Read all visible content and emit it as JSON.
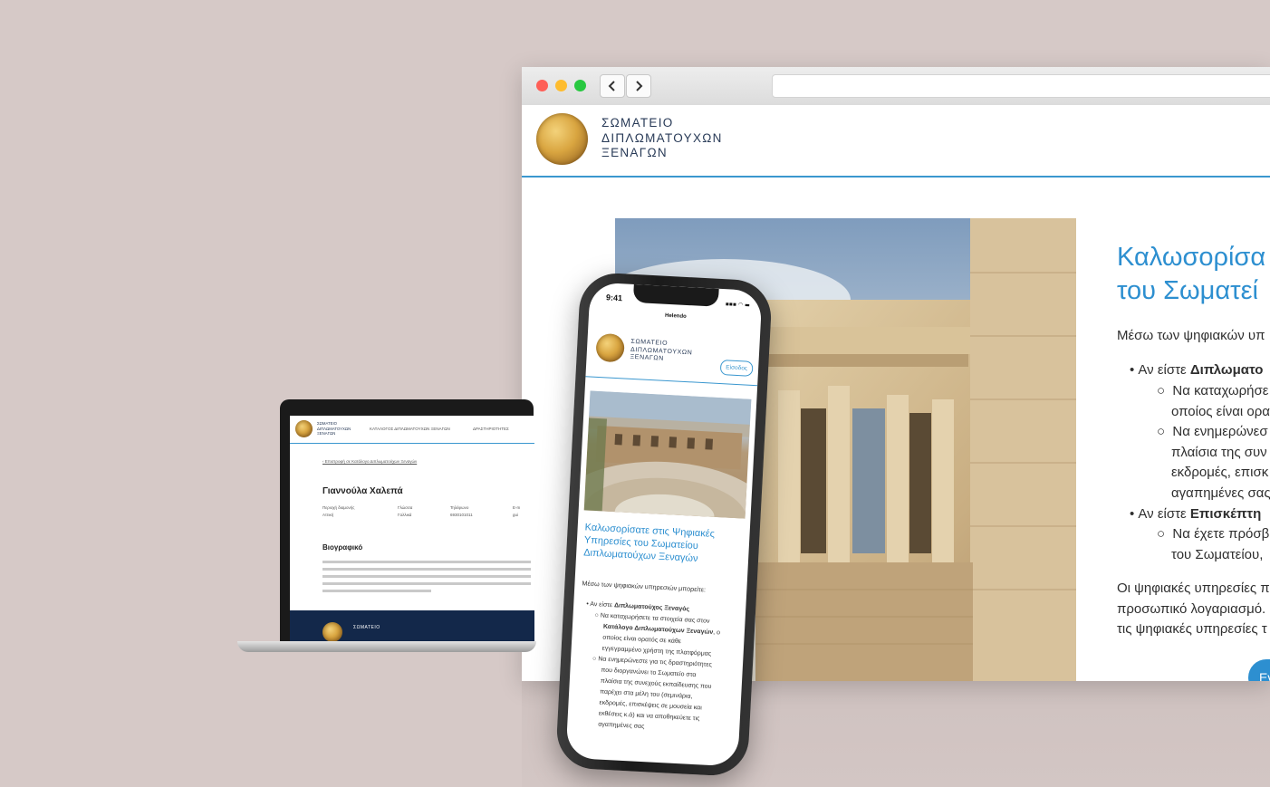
{
  "browser": {
    "site_logo_lines": [
      "ΣΩΜΑΤΕΙΟ",
      "ΔΙΠΛΩΜΑΤΟΥΧΩΝ",
      "ΞΕΝΑΓΩΝ"
    ],
    "hero_title_lines": [
      "Καλωσορίσα",
      "του Σωματεί"
    ],
    "intro": "Μέσω των ψηφιακών υπ",
    "bullets": [
      {
        "prefix": "Αν είστε ",
        "bold": "Διπλωματο"
      },
      {
        "prefix": "Να καταχωρήσε",
        "bold": ""
      },
      {
        "prefix": "οποίος είναι ορα",
        "bold": ""
      },
      {
        "prefix": "Να ενημερώνεσ",
        "bold": ""
      },
      {
        "prefix": "πλαίσια της συν",
        "bold": ""
      },
      {
        "prefix": "εκδρομές, επισκ",
        "bold": ""
      },
      {
        "prefix": "αγαπημένες σας",
        "bold": ""
      },
      {
        "prefix": "Αν είστε ",
        "bold": "Επισκέπτη"
      },
      {
        "prefix": "Να έχετε πρόσβ",
        "bold": ""
      },
      {
        "prefix": "του Σωματείου,",
        "bold": ""
      }
    ],
    "closing": [
      "Οι ψηφιακές υπηρεσίες π",
      "προσωπικό λογαριασμό.",
      "τις ψηφιακές υπηρεσίες τ"
    ],
    "cta_label": "Εν"
  },
  "laptop": {
    "logo_lines": [
      "ΣΩΜΑΤΕΙΟ",
      "ΔΙΠΛΩΜΑΤΟΥΧΩΝ",
      "ΞΕΝΑΓΩΝ"
    ],
    "menu": [
      "ΚΑΤΑΛΟΓΟΣ ΔΙΠΛΩΜΑΤΟΥΧΩΝ ΞΕΝΑΓΩΝ",
      "ΔΡΑΣΤΗΡΙΟΤΗΤΕΣ"
    ],
    "back_link": "‹ Επιστροφή σε Κατάλογο Διπλωματούχων Ξεναγών",
    "person_name": "Γιαννούλα Χαλεπά",
    "fields": [
      {
        "label": "Περιοχή διαμονής",
        "value": "Αττική"
      },
      {
        "label": "Γλώσσα",
        "value": "Γαλλικά"
      },
      {
        "label": "Τηλέφωνο",
        "value": "6930101011"
      },
      {
        "label": "E-m",
        "value": "gui"
      }
    ],
    "bio_heading": "Βιογραφικό",
    "footer_text": "ΣΩΜΑΤΕΙΟ"
  },
  "phone": {
    "time": "9:41",
    "status": "▪▪▪ ◠ ▬",
    "host": "Helendo",
    "logo_lines": [
      "ΣΩΜΑΤΕΙΟ",
      "ΔΙΠΛΩΜΑΤΟΥΧΩΝ",
      "ΞΕΝΑΓΩΝ"
    ],
    "login_label": "Είσοδος",
    "title_lines": [
      "Καλωσορίσατε στις Ψηφιακές",
      "Υπηρεσίες του Σωματείου",
      "Διπλωματούχων Ξεναγών"
    ],
    "intro": "Μέσω των ψηφιακών υπηρεσιών μπορείτε:",
    "list": [
      {
        "prefix": "• Αν είστε ",
        "bold": "Διπλωματούχος Ξεναγός",
        "rest": ""
      },
      {
        "prefix": "○ Να καταχωρήσετε τα στοιχεία σας στον",
        "bold": "",
        "rest": ""
      },
      {
        "prefix": "",
        "bold": "Κατάλογο Διπλωματούχων Ξεναγών",
        "rest": ", ο"
      },
      {
        "prefix": "οποίος είναι ορατός σε κάθε",
        "bold": "",
        "rest": ""
      },
      {
        "prefix": "εγγεγραμμένο χρήστη της πλατφόρμας",
        "bold": "",
        "rest": ""
      },
      {
        "prefix": "○ Να ενημερώνεστε για τις δραστηριότητες",
        "bold": "",
        "rest": ""
      },
      {
        "prefix": "που διοργανώνει το Σωματείο στα",
        "bold": "",
        "rest": ""
      },
      {
        "prefix": "πλαίσια της συνεχούς εκπαίδευσης που",
        "bold": "",
        "rest": ""
      },
      {
        "prefix": "παρέχει στα μέλη του (σεμινάρια,",
        "bold": "",
        "rest": ""
      },
      {
        "prefix": "εκδρομές, επισκέψεις σε μουσεία και",
        "bold": "",
        "rest": ""
      },
      {
        "prefix": "εκθέσεις κ.ά) και να αποθηκεύετε τις",
        "bold": "",
        "rest": ""
      },
      {
        "prefix": "αγαπημένες σας",
        "bold": "",
        "rest": ""
      }
    ]
  }
}
